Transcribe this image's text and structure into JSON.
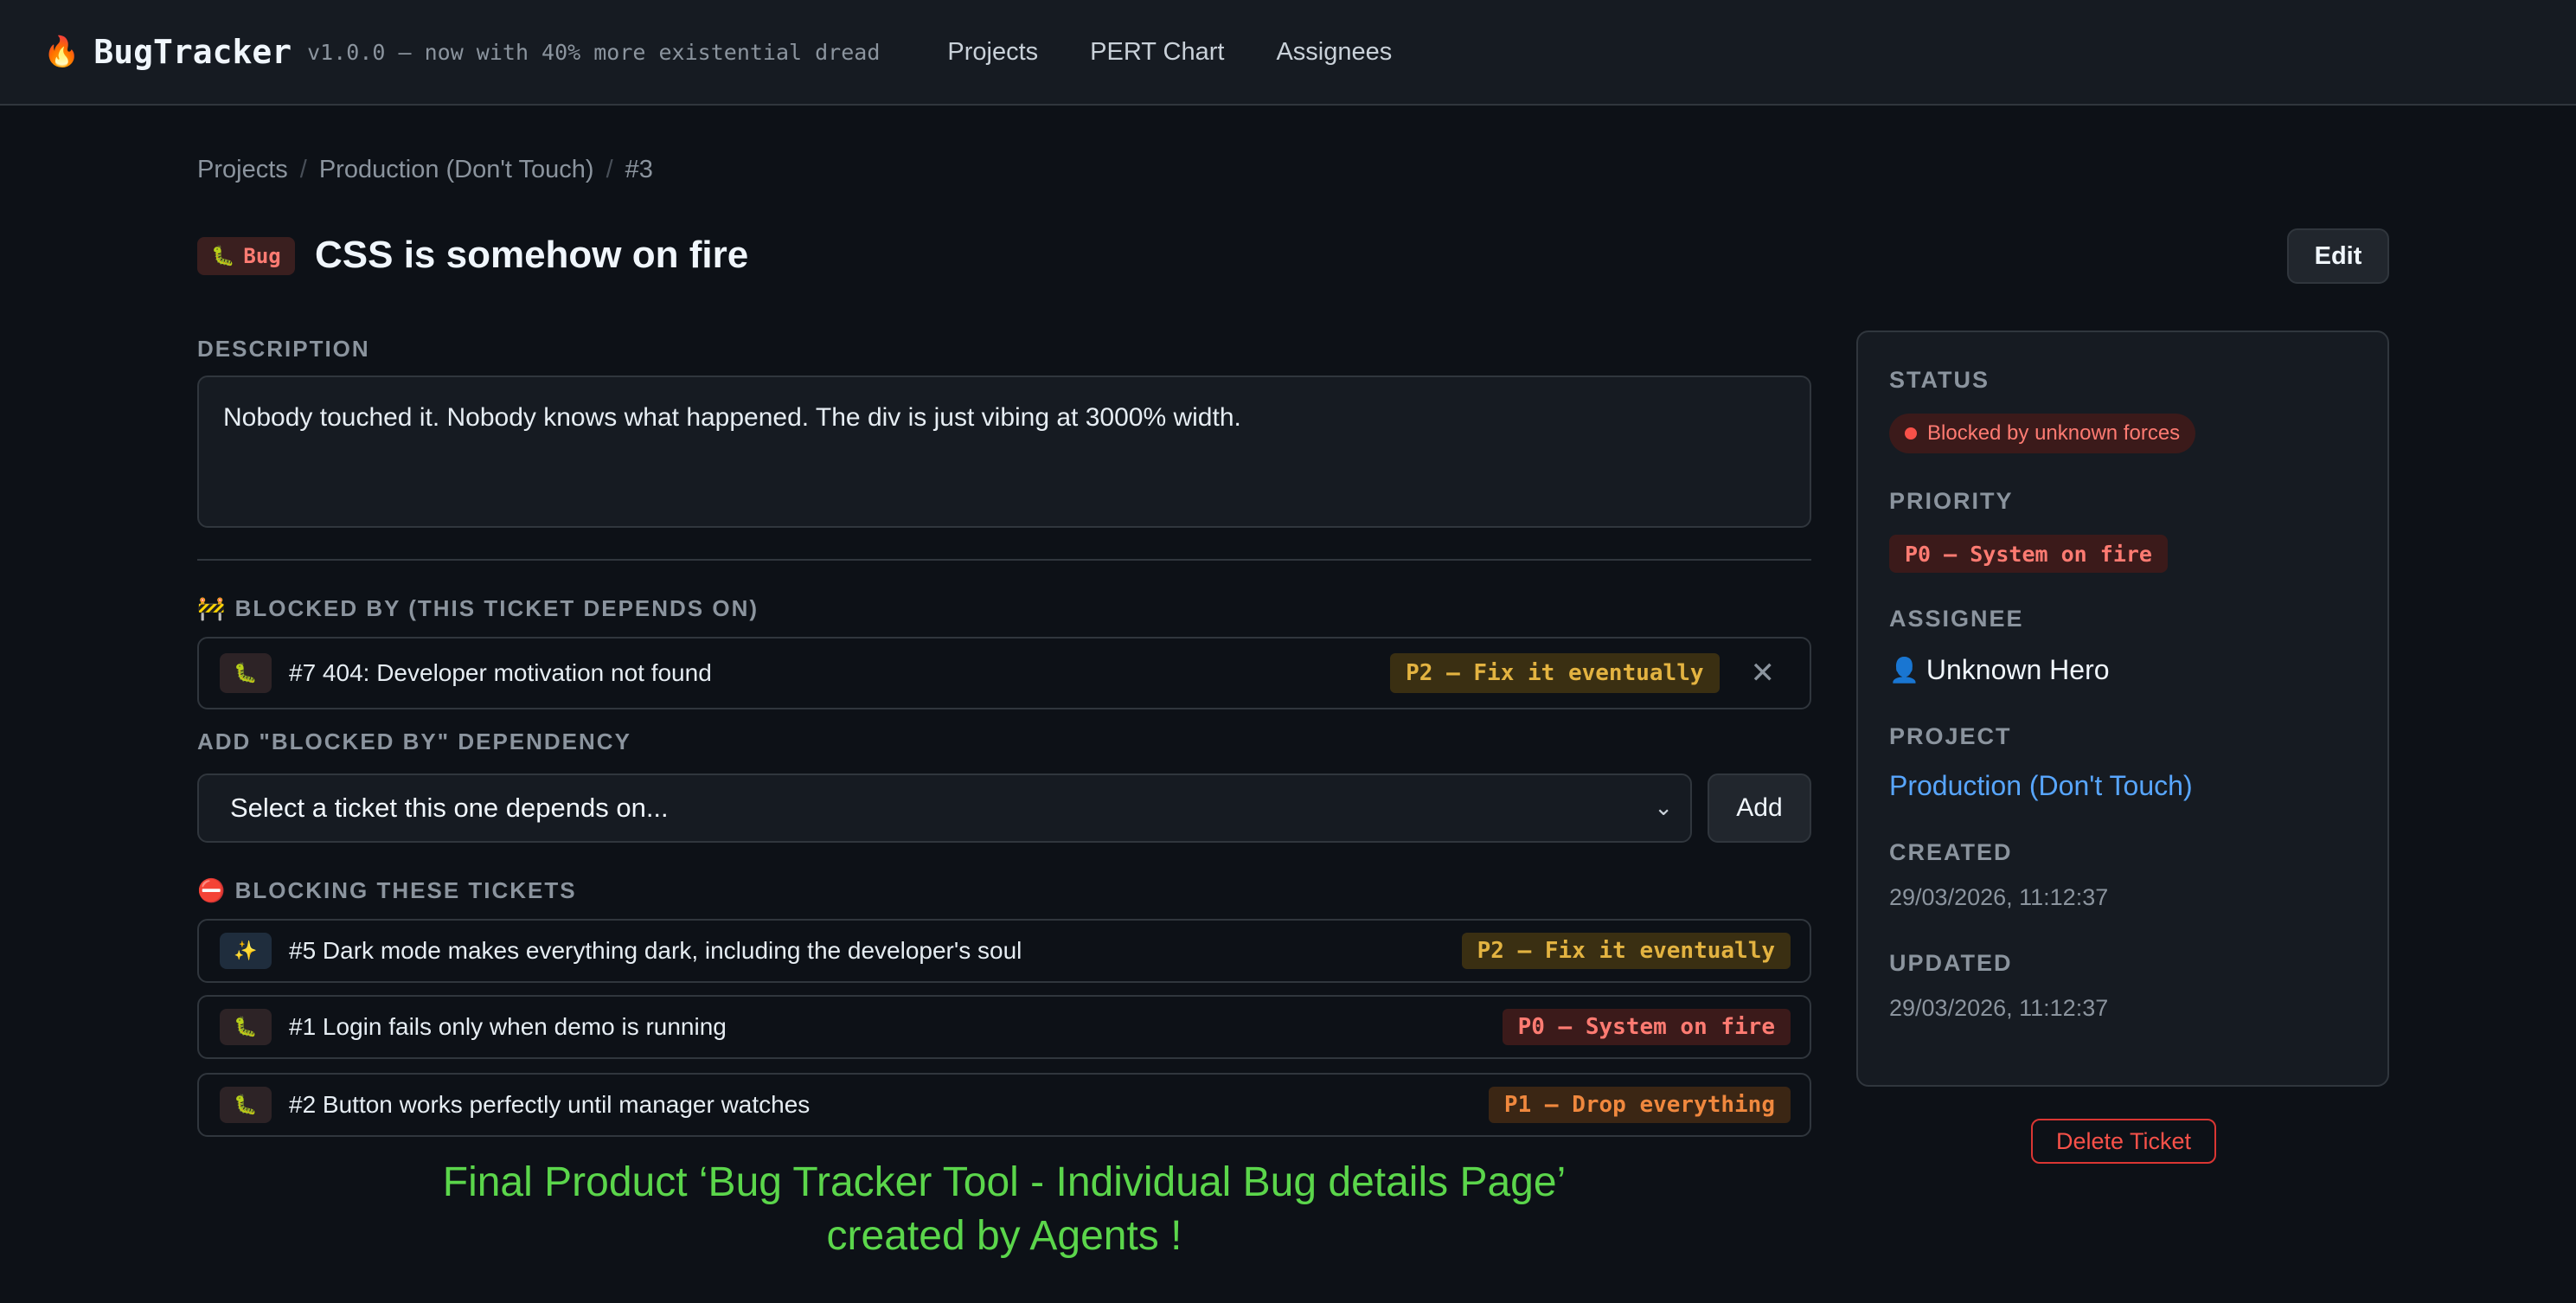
{
  "app": {
    "name": "BugTracker",
    "flame_icon": "🔥",
    "version": "v1.0.0 — now with 40% more existential dread"
  },
  "nav": {
    "items": [
      "Projects",
      "PERT Chart",
      "Assignees"
    ]
  },
  "breadcrumb": [
    "Projects",
    "Production (Don't Touch)",
    "#3"
  ],
  "ticket": {
    "type_icon": "🐛",
    "type_label": "Bug",
    "title": "CSS is somehow on fire",
    "edit_label": "Edit",
    "description_label": "DESCRIPTION",
    "description": "Nobody touched it. Nobody knows what happened. The div is just vibing at 3000% width."
  },
  "blocked_by": {
    "label": "🚧 BLOCKED BY (THIS TICKET DEPENDS ON)",
    "items": [
      {
        "icon": "🐛",
        "text": "#7 404: Developer motivation not found",
        "priority": "P2 — Fix it eventually",
        "remove": "✕"
      }
    ]
  },
  "add_dependency": {
    "label": "ADD \"BLOCKED BY\" DEPENDENCY",
    "placeholder": "Select a ticket this one depends on...",
    "add_label": "Add"
  },
  "blocking": {
    "label": "⛔ BLOCKING THESE TICKETS",
    "items": [
      {
        "icon": "✨",
        "text": "#5 Dark mode makes everything dark, including the developer's soul",
        "priority": "P2 — Fix it eventually"
      },
      {
        "icon": "🐛",
        "text": "#1 Login fails only when demo is running",
        "priority": "P0 — System on fire"
      },
      {
        "icon": "🐛",
        "text": "#2 Button works perfectly until manager watches",
        "priority": "P1 — Drop everything"
      }
    ]
  },
  "sidebar": {
    "status_label": "STATUS",
    "status_value": "Blocked by unknown forces",
    "priority_label": "PRIORITY",
    "priority_value": "P0 — System on fire",
    "assignee_label": "ASSIGNEE",
    "assignee_icon": "👤",
    "assignee_value": "Unknown Hero",
    "project_label": "PROJECT",
    "project_value": "Production (Don't Touch)",
    "created_label": "CREATED",
    "created_value": "29/03/2026, 11:12:37",
    "updated_label": "UPDATED",
    "updated_value": "29/03/2026, 11:12:37"
  },
  "delete_label": "Delete Ticket",
  "caption": {
    "line1": "Final Product ‘Bug Tracker Tool - Individual Bug details Page’",
    "line2": "created by Agents !"
  },
  "colors": {
    "background": "#0d1117",
    "accent_link": "#58a6ff",
    "danger": "#f85149",
    "p2": "#e3b341",
    "p1": "#f0883e",
    "caption": "#5bd64b"
  }
}
